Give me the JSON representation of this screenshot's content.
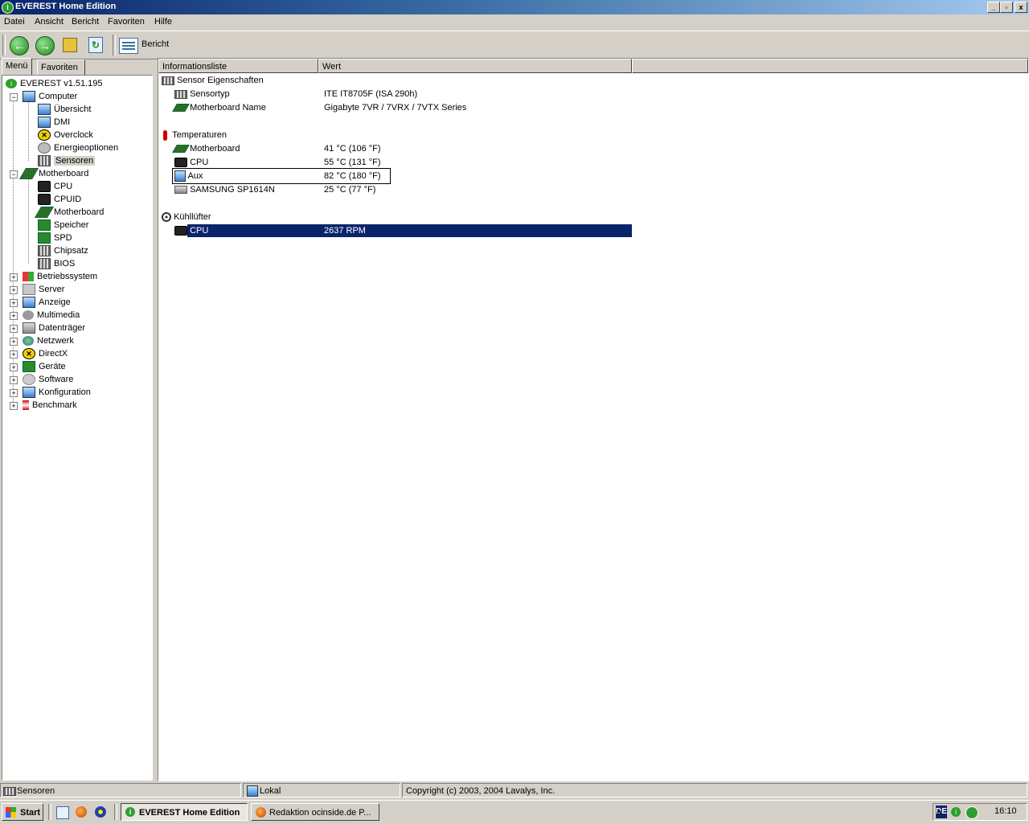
{
  "window": {
    "title": "EVEREST Home Edition"
  },
  "menubar": [
    "Datei",
    "Ansicht",
    "Bericht",
    "Favoriten",
    "Hilfe"
  ],
  "toolbar": {
    "report_label": "Bericht"
  },
  "left_tabs": [
    "Menü",
    "Favoriten"
  ],
  "tree": {
    "root": "EVEREST v1.51.195",
    "computer": "Computer",
    "computer_children": [
      "Übersicht",
      "DMI",
      "Overclock",
      "Energieoptionen",
      "Sensoren"
    ],
    "motherboard": "Motherboard",
    "motherboard_children": [
      "CPU",
      "CPUID",
      "Motherboard",
      "Speicher",
      "SPD",
      "Chipsatz",
      "BIOS"
    ],
    "collapsed": [
      "Betriebssystem",
      "Server",
      "Anzeige",
      "Multimedia",
      "Datenträger",
      "Netzwerk",
      "DirectX",
      "Geräte",
      "Software",
      "Konfiguration",
      "Benchmark"
    ]
  },
  "columns": [
    "Informationsliste",
    "Wert"
  ],
  "groups": {
    "sensor": {
      "title": "Sensor Eigenschaften",
      "rows": [
        {
          "label": "Sensortyp",
          "value": "ITE IT8705F  (ISA 290h)"
        },
        {
          "label": "Motherboard Name",
          "value": "Gigabyte 7VR / 7VRX / 7VTX Series"
        }
      ]
    },
    "temps": {
      "title": "Temperaturen",
      "rows": [
        {
          "label": "Motherboard",
          "value": "41 °C  (106 °F)"
        },
        {
          "label": "CPU",
          "value": "55 °C  (131 °F)"
        },
        {
          "label": "Aux",
          "value": "82 °C  (180 °F)"
        },
        {
          "label": "SAMSUNG SP1614N",
          "value": "25 °C  (77 °F)"
        }
      ]
    },
    "fans": {
      "title": "Kühllüfter",
      "rows": [
        {
          "label": "CPU",
          "value": "2637 RPM"
        }
      ]
    }
  },
  "statusbar": {
    "left": "Sensoren",
    "middle": "Lokal",
    "right": "Copyright (c) 2003, 2004 Lavalys, Inc."
  },
  "taskbar": {
    "start": "Start",
    "tasks": [
      "EVEREST Home Edition",
      "Redaktion ocinside.de P..."
    ],
    "lang": "DE",
    "clock": "16:10",
    "tray_chevron": "«"
  }
}
